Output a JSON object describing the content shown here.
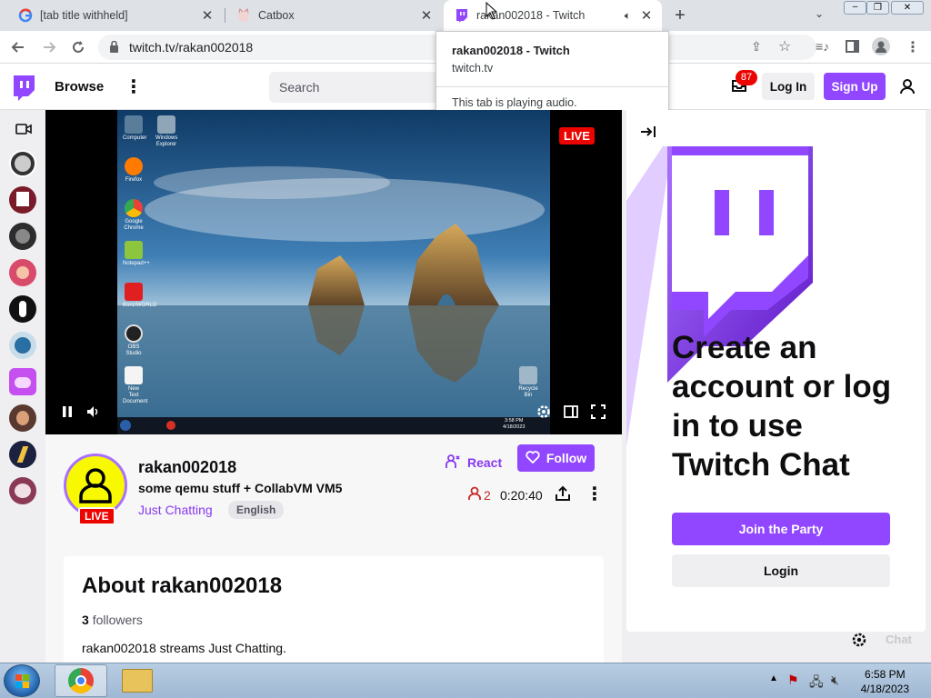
{
  "browser": {
    "tabs": [
      {
        "title": "[tab title withheld]",
        "favicon": "google-icon"
      },
      {
        "title": "Catbox",
        "favicon": "catbox-icon"
      },
      {
        "title": "rakan002018 - Twitch",
        "favicon": "twitch-icon",
        "active": true
      }
    ],
    "url": "twitch.tv/rakan002018"
  },
  "hover_card": {
    "title": "rakan002018 - Twitch",
    "domain": "twitch.tv",
    "status": "This tab is playing audio."
  },
  "twitch_nav": {
    "browse": "Browse",
    "search_placeholder": "Search",
    "notifications_count": "87",
    "login": "Log In",
    "signup": "Sign Up"
  },
  "player": {
    "live_label": "LIVE",
    "desktop_icons": [
      "Computer",
      "Windows Explorer",
      "Firefox",
      "Google Chrome",
      "Notepad++",
      "BonziWORLD",
      "OBS Studio",
      "New Text Document"
    ],
    "recycle_bin_label": "Recycle Bin",
    "guest_clock": [
      "3:58 PM",
      "4/18/2023"
    ]
  },
  "channel": {
    "name": "rakan002018",
    "stream_title": "some qemu stuff + CollabVM VM5",
    "category": "Just Chatting",
    "language": "English",
    "live_label": "LIVE",
    "react_label": "React",
    "follow_label": "Follow",
    "viewers": "2",
    "uptime": "0:20:40"
  },
  "about": {
    "title": "About rakan002018",
    "followers_count": "3",
    "followers_label": "followers",
    "description": "rakan002018 streams Just Chatting."
  },
  "chat": {
    "headline": "Create an account or log in to use Twitch Chat",
    "join_label": "Join the Party",
    "login_label": "Login",
    "footer_label": "Chat"
  },
  "taskbar": {
    "time": "6:58 PM",
    "date": "4/18/2023"
  },
  "colors": {
    "twitch_purple": "#9147ff",
    "live_red": "#eb0400",
    "accent_text": "#8839ef"
  }
}
